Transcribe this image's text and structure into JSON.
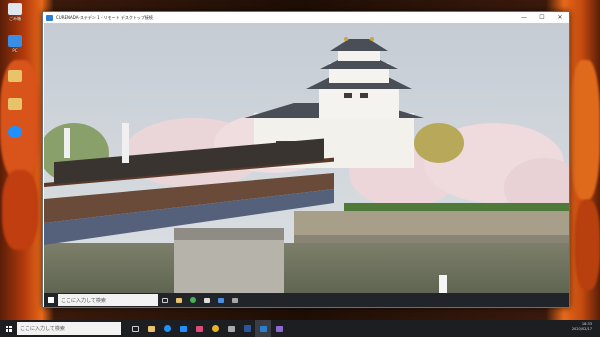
{
  "outer_desktop": {
    "icons": [
      {
        "label": "ごみ箱",
        "icon": "recycle-bin-icon",
        "color": "#dfe6ee"
      },
      {
        "label": "PC",
        "icon": "computer-icon",
        "color": "#3a8ee6"
      },
      {
        "label": "",
        "icon": "folder-icon",
        "color": "#e8c36a"
      },
      {
        "label": "",
        "icon": "folder-icon",
        "color": "#e8c36a"
      },
      {
        "label": "",
        "icon": "edge-icon",
        "color": "#1e90ff"
      }
    ]
  },
  "remote_window": {
    "title": "CURENADA-ステデン 1 - リモート デスクトップ接続",
    "controls": {
      "minimize": "—",
      "maximize": "☐",
      "close": "✕"
    }
  },
  "remote_taskbar": {
    "search_placeholder": "ここに入力して検索",
    "icons": [
      "task-view-icon",
      "file-explorer-icon",
      "chrome-icon",
      "store-icon",
      "mail-icon",
      "photos-icon"
    ]
  },
  "taskbar": {
    "search_placeholder": "ここに入力して検索",
    "icons": [
      "task-view-icon",
      "file-explorer-icon",
      "edge-icon",
      "store-icon",
      "mail-icon",
      "chrome-icon",
      "photos-icon",
      "word-icon",
      "remote-desktop-icon",
      "app-icon"
    ],
    "time": "18:33",
    "date": "2020/02/17"
  },
  "colors": {
    "accent": "#2d7dd2",
    "taskbar": "#1d1e22",
    "remote_taskbar": "#16181e"
  }
}
